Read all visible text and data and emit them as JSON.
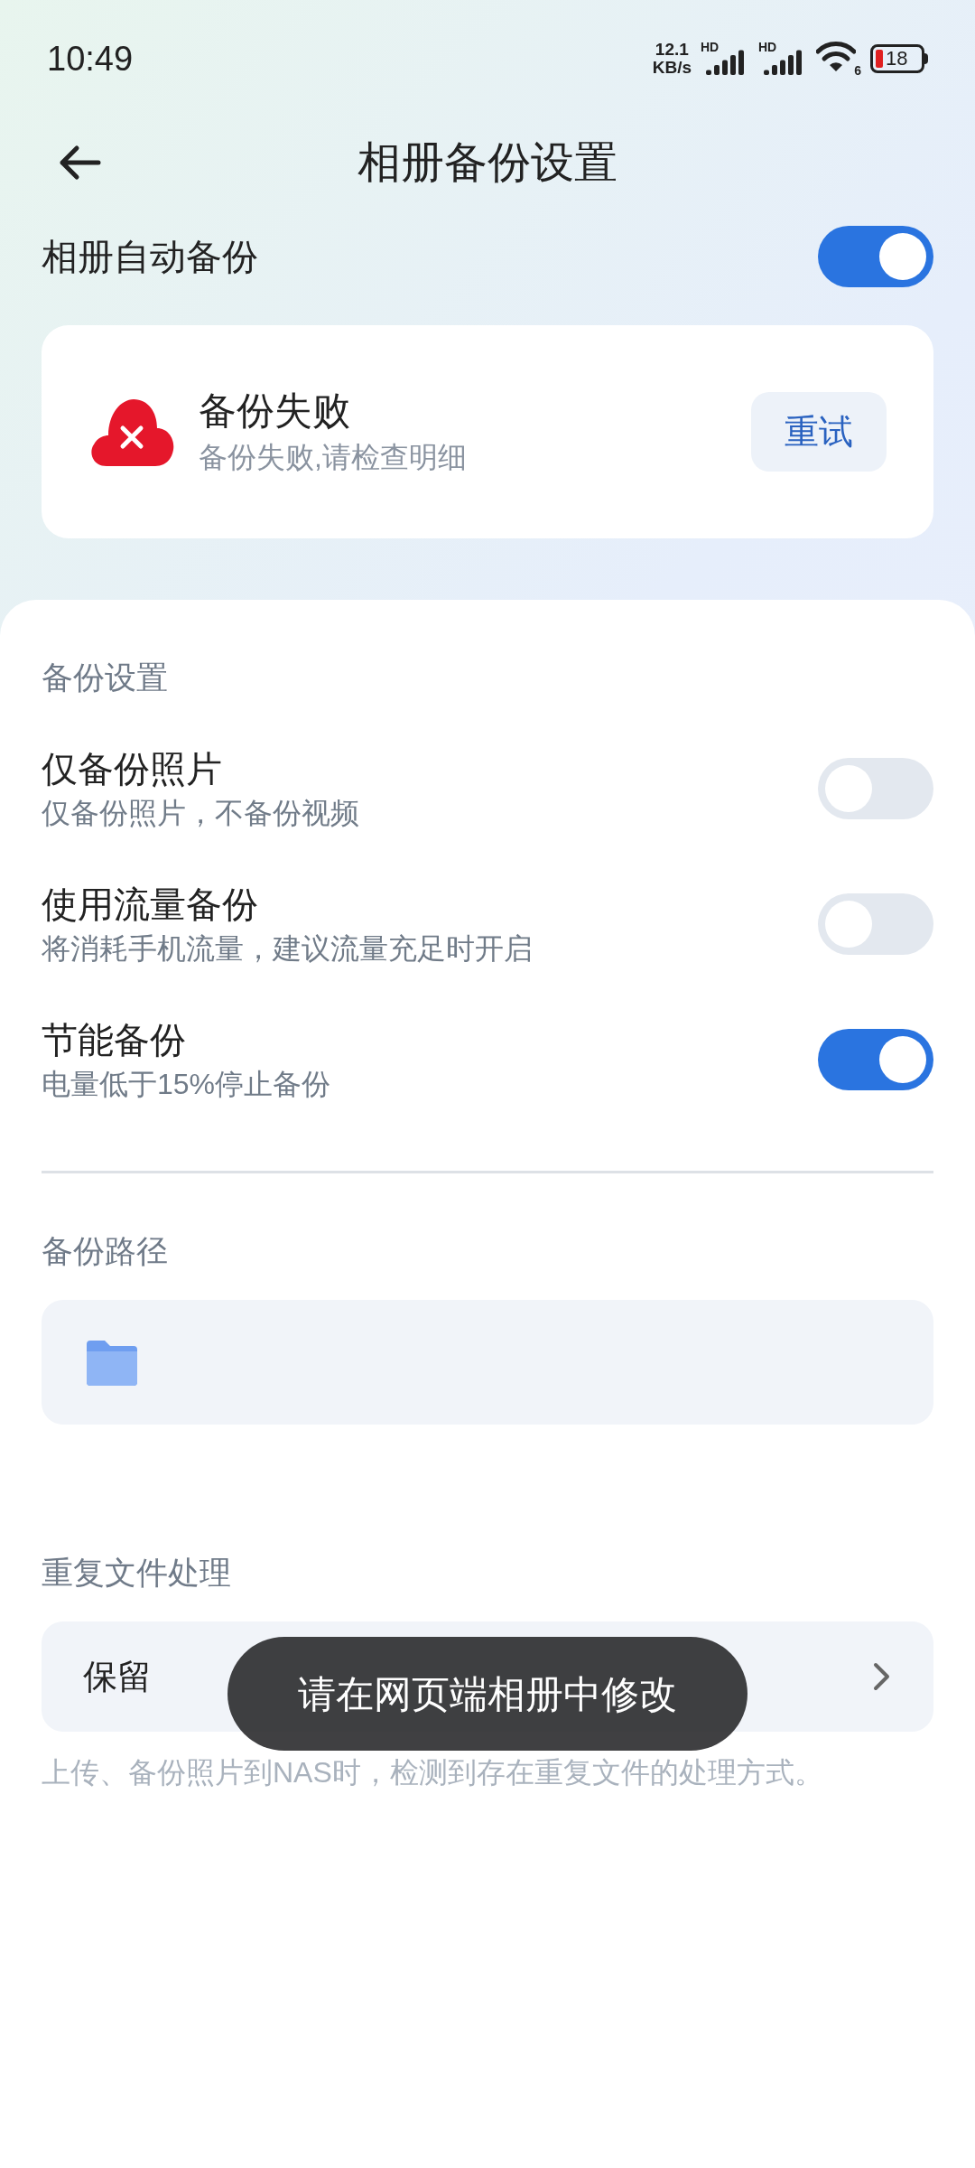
{
  "status_bar": {
    "time": "10:49",
    "net_speed_value": "12.1",
    "net_speed_unit": "KB/s",
    "sim1_label": "HD",
    "sim2_label": "HD",
    "wifi_label": "6",
    "battery": "18"
  },
  "header": {
    "title": "相册备份设置"
  },
  "auto_backup": {
    "label": "相册自动备份",
    "on": true
  },
  "status_card": {
    "title": "备份失败",
    "subtitle": "备份失败,请检查明细",
    "button": "重试"
  },
  "backup_settings": {
    "heading": "备份设置",
    "rows": [
      {
        "title": "仅备份照片",
        "subtitle": "仅备份照片，不备份视频",
        "on": false
      },
      {
        "title": "使用流量备份",
        "subtitle": "将消耗手机流量，建议流量充足时开启",
        "on": false
      },
      {
        "title": "节能备份",
        "subtitle": "电量低于15%停止备份",
        "on": true
      }
    ]
  },
  "backup_path": {
    "heading": "备份路径"
  },
  "duplicate_handling": {
    "heading": "重复文件处理",
    "value": "保留",
    "note": "上传、备份照片到NAS时，检测到存在重复文件的处理方式。"
  },
  "toast": {
    "text": "请在网页端相册中修改"
  }
}
